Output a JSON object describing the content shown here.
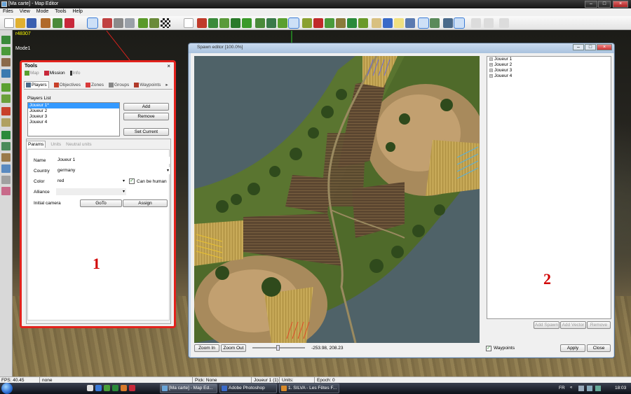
{
  "window": {
    "title": "[Ma carte] - Map Editor"
  },
  "menu": [
    "Files",
    "View",
    "Mode",
    "Tools",
    "Help"
  ],
  "overlay": {
    "coord": "r48307",
    "mode": "Mode1"
  },
  "tools_panel": {
    "title": "Tools",
    "close": "×",
    "top_tabs": [
      "Map",
      "Mission",
      "Info"
    ],
    "sub_tabs": [
      "Players",
      "Objectives",
      "Zones",
      "Groups",
      "Waypoints"
    ],
    "players_list_label": "Players List",
    "players": [
      "Joueur 1*",
      "Joueur 2",
      "Joueur 3",
      "Joueur 4"
    ],
    "buttons": {
      "add": "Add",
      "remove": "Remove",
      "set_current": "Set Current"
    },
    "param_tabs": [
      "Params",
      "Units",
      "Neutral units"
    ],
    "fields": {
      "name_label": "Name",
      "name_value": "Joueur 1",
      "country_label": "Country",
      "country_value": "germany",
      "color_label": "Color",
      "color_value": "red",
      "can_be_human": "Can be human",
      "alliance_label": "Alliance",
      "initial_camera_label": "Initial camera",
      "goto": "GoTo",
      "assign": "Assign"
    },
    "callout": "1"
  },
  "spawn_editor": {
    "title": "Spawn editor [100.0%]",
    "tree": [
      "Joueur 1",
      "Joueur 2",
      "Joueur 3",
      "Joueur 4"
    ],
    "zoom_in": "Zoom In",
    "zoom_out": "Zoom Out",
    "coords": "-253.98, 208.23",
    "add_spawn": "Add Spawn",
    "add_vector": "Add Vector",
    "remove": "Remove",
    "waypoints": "Waypoints",
    "apply": "Apply",
    "close": "Close",
    "callout": "2"
  },
  "statusbar": {
    "fps": "FPS: 40.45",
    "mode": "none",
    "pick": "Pick: None",
    "player": "Joueur 1 (1)",
    "units": "Units:",
    "epoch": "Epoch: 0"
  },
  "taskbar": {
    "tasks": [
      "[Ma carte] - Map Ed...",
      "Adobe Photoshop",
      "1. SILVA - Les Fêtes F..."
    ],
    "lang": "FR",
    "clock": "18:03"
  },
  "colors": {
    "callout": "#d10000",
    "highlight": "#e2221c",
    "selection": "#3399ff"
  }
}
